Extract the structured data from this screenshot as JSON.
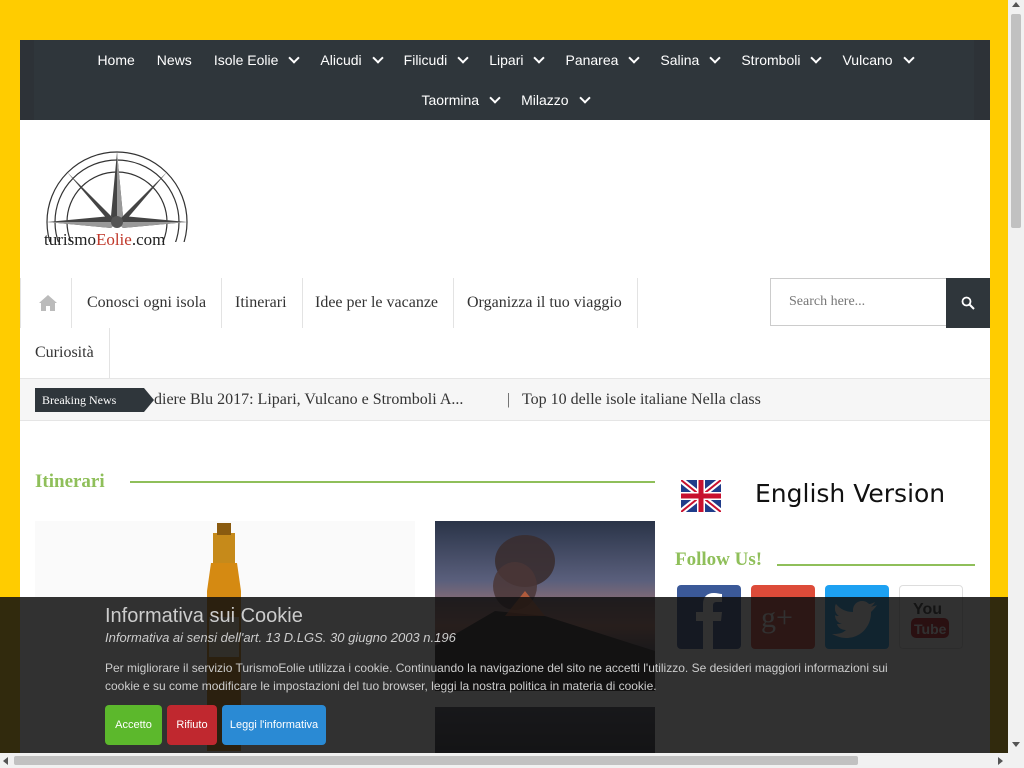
{
  "top_nav": {
    "row1": [
      {
        "label": "Home",
        "dropdown": false
      },
      {
        "label": "News",
        "dropdown": false
      },
      {
        "label": "Isole Eolie",
        "dropdown": true
      },
      {
        "label": "Alicudi",
        "dropdown": true
      },
      {
        "label": "Filicudi",
        "dropdown": true
      },
      {
        "label": "Lipari",
        "dropdown": true
      },
      {
        "label": "Panarea",
        "dropdown": true
      },
      {
        "label": "Salina",
        "dropdown": true
      },
      {
        "label": "Stromboli",
        "dropdown": true
      },
      {
        "label": "Vulcano",
        "dropdown": true
      }
    ],
    "row2": [
      {
        "label": "Taormina",
        "dropdown": true
      },
      {
        "label": "Milazzo",
        "dropdown": true
      }
    ]
  },
  "logo": {
    "part1": "turismo",
    "part2": "Eolie",
    "part3": ".com"
  },
  "main_nav": {
    "items": [
      "Conosci ogni isola",
      "Itinerari",
      "Idee per le vacanze",
      "Organizza il tuo viaggio",
      "Curiosità"
    ],
    "search_placeholder": "Search here..."
  },
  "breaking": {
    "label": "Breaking News",
    "ticker1": "diere Blu  2017: Lipari, Vulcano e Stromboli A...",
    "separator": "|",
    "ticker2": "Top 10 delle isole italiane Nella class"
  },
  "content": {
    "section_title": "Itinerari"
  },
  "sidebar": {
    "english_version": "English Version",
    "follow_title": "Follow Us!",
    "social": [
      "facebook-icon",
      "google-plus-icon",
      "twitter-icon",
      "youtube-icon"
    ]
  },
  "cookie": {
    "title": "Informativa sui Cookie",
    "subtitle": "Informativa ai sensi dell'art. 13 D.LGS. 30 giugno 2003 n.196",
    "body": "Per migliorare il servizio TurismoEolie utilizza i cookie. Continuando la navigazione del sito ne accetti l'utilizzo. Se desideri maggiori informazioni sui cookie e su come modificare le impostazioni del tuo browser, leggi la nostra politica in materia di cookie.",
    "accept": "Accetto",
    "reject": "Rifiuto",
    "read": "Leggi l'informativa"
  },
  "colors": {
    "background": "#ffcc00",
    "nav_dark": "#2f363b",
    "accent_green": "#8fbf5a",
    "btn_accept": "#5cb82c",
    "btn_reject": "#c0282f",
    "btn_read": "#2a8ad4"
  }
}
